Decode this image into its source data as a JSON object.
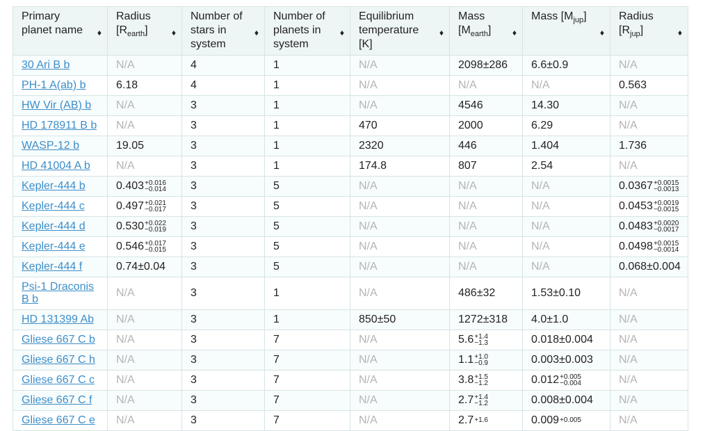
{
  "table": {
    "columns": [
      {
        "key": "name",
        "label": "Primary planet name",
        "sort_icon": "♦"
      },
      {
        "key": "radius_earth",
        "label": "Radius [R",
        "sub": "earth",
        "label_end": "]",
        "sort_icon": "♦"
      },
      {
        "key": "stars",
        "label": "Number of stars in system",
        "sort_icon": "♦"
      },
      {
        "key": "planets",
        "label": "Number of planets in system",
        "sort_icon": "♦"
      },
      {
        "key": "teq",
        "label": "Equilibrium temperature [K]",
        "sort_icon": "♦"
      },
      {
        "key": "mass_earth",
        "label": "Mass [M",
        "sub": "earth",
        "label_end": "]",
        "sort_icon": "♦"
      },
      {
        "key": "mass_jup",
        "label": "Mass [M",
        "sub": "jup",
        "label_end": "]",
        "sort_icon": "♦"
      },
      {
        "key": "radius_jup",
        "label": "Radius [R",
        "sub": "jup",
        "label_end": "]",
        "sort_icon": "♦"
      }
    ],
    "rows": [
      {
        "name": "30 Ari B b",
        "radius_earth": "N/A",
        "stars": "4",
        "planets": "1",
        "teq": "N/A",
        "mass_earth": "2098±286",
        "mass_jup": "6.6±0.9",
        "radius_jup": "N/A"
      },
      {
        "name": "PH-1 A(ab) b",
        "radius_earth": "6.18",
        "stars": "4",
        "planets": "1",
        "teq": "N/A",
        "mass_earth": "N/A",
        "mass_jup": "N/A",
        "radius_jup": "0.563"
      },
      {
        "name": "HW Vir (AB) b",
        "radius_earth": "N/A",
        "stars": "3",
        "planets": "1",
        "teq": "N/A",
        "mass_earth": "4546",
        "mass_jup": "14.30",
        "radius_jup": "N/A"
      },
      {
        "name": "HD 178911 B b",
        "radius_earth": "N/A",
        "stars": "3",
        "planets": "1",
        "teq": "470",
        "mass_earth": "2000",
        "mass_jup": "6.29",
        "radius_jup": "N/A"
      },
      {
        "name": "WASP-12 b",
        "radius_earth": "19.05",
        "stars": "3",
        "planets": "1",
        "teq": "2320",
        "mass_earth": "446",
        "mass_jup": "1.404",
        "radius_jup": "1.736"
      },
      {
        "name": "HD 41004 A b",
        "radius_earth": "N/A",
        "stars": "3",
        "planets": "1",
        "teq": "174.8",
        "mass_earth": "807",
        "mass_jup": "2.54",
        "radius_jup": "N/A"
      },
      {
        "name": "Kepler-444 b",
        "radius_earth": {
          "v": "0.403",
          "up": "+0.016",
          "dn": "−0.014"
        },
        "stars": "3",
        "planets": "5",
        "teq": "N/A",
        "mass_earth": "N/A",
        "mass_jup": "N/A",
        "radius_jup": {
          "v": "0.0367",
          "up": "+0.0015",
          "dn": "−0.0013"
        }
      },
      {
        "name": "Kepler-444 c",
        "radius_earth": {
          "v": "0.497",
          "up": "+0.021",
          "dn": "−0.017"
        },
        "stars": "3",
        "planets": "5",
        "teq": "N/A",
        "mass_earth": "N/A",
        "mass_jup": "N/A",
        "radius_jup": {
          "v": "0.0453",
          "up": "+0.0019",
          "dn": "−0.0015"
        }
      },
      {
        "name": "Kepler-444 d",
        "radius_earth": {
          "v": "0.530",
          "up": "+0.022",
          "dn": "−0.019"
        },
        "stars": "3",
        "planets": "5",
        "teq": "N/A",
        "mass_earth": "N/A",
        "mass_jup": "N/A",
        "radius_jup": {
          "v": "0.0483",
          "up": "+0.0020",
          "dn": "−0.0017"
        }
      },
      {
        "name": "Kepler-444 e",
        "radius_earth": {
          "v": "0.546",
          "up": "+0.017",
          "dn": "−0.015"
        },
        "stars": "3",
        "planets": "5",
        "teq": "N/A",
        "mass_earth": "N/A",
        "mass_jup": "N/A",
        "radius_jup": {
          "v": "0.0498",
          "up": "+0.0015",
          "dn": "−0.0014"
        }
      },
      {
        "name": "Kepler-444 f",
        "radius_earth": "0.74±0.04",
        "stars": "3",
        "planets": "5",
        "teq": "N/A",
        "mass_earth": "N/A",
        "mass_jup": "N/A",
        "radius_jup": "0.068±0.004"
      },
      {
        "name": "Psi-1 Draconis B b",
        "radius_earth": "N/A",
        "stars": "3",
        "planets": "1",
        "teq": "N/A",
        "mass_earth": "486±32",
        "mass_jup": "1.53±0.10",
        "radius_jup": "N/A",
        "tall": true
      },
      {
        "name": "HD 131399 Ab",
        "radius_earth": "N/A",
        "stars": "3",
        "planets": "1",
        "teq": "850±50",
        "mass_earth": "1272±318",
        "mass_jup": "4.0±1.0",
        "radius_jup": "N/A"
      },
      {
        "name": "Gliese 667 C b",
        "radius_earth": "N/A",
        "stars": "3",
        "planets": "7",
        "teq": "N/A",
        "mass_earth": {
          "v": "5.6",
          "up": "+1.4",
          "dn": "−1.3"
        },
        "mass_jup": "0.018±0.004",
        "radius_jup": "N/A"
      },
      {
        "name": "Gliese 667 C h",
        "radius_earth": "N/A",
        "stars": "3",
        "planets": "7",
        "teq": "N/A",
        "mass_earth": {
          "v": "1.1",
          "up": "+1.0",
          "dn": "−0.9"
        },
        "mass_jup": "0.003±0.003",
        "radius_jup": "N/A"
      },
      {
        "name": "Gliese 667 C c",
        "radius_earth": "N/A",
        "stars": "3",
        "planets": "7",
        "teq": "N/A",
        "mass_earth": {
          "v": "3.8",
          "up": "+1.5",
          "dn": "−1.2"
        },
        "mass_jup": {
          "v": "0.012",
          "up": "+0.005",
          "dn": "−0.004"
        },
        "radius_jup": "N/A"
      },
      {
        "name": "Gliese 667 C f",
        "radius_earth": "N/A",
        "stars": "3",
        "planets": "7",
        "teq": "N/A",
        "mass_earth": {
          "v": "2.7",
          "up": "+1.4",
          "dn": "−1.2"
        },
        "mass_jup": "0.008±0.004",
        "radius_jup": "N/A"
      },
      {
        "name": "Gliese 667 C e",
        "radius_earth": "N/A",
        "stars": "3",
        "planets": "7",
        "teq": "N/A",
        "mass_earth": {
          "v": "2.7",
          "up": "+1.6",
          "dn": ""
        },
        "mass_jup": {
          "v": "0.009",
          "up": "+0.005",
          "dn": ""
        },
        "radius_jup": "N/A"
      }
    ]
  }
}
